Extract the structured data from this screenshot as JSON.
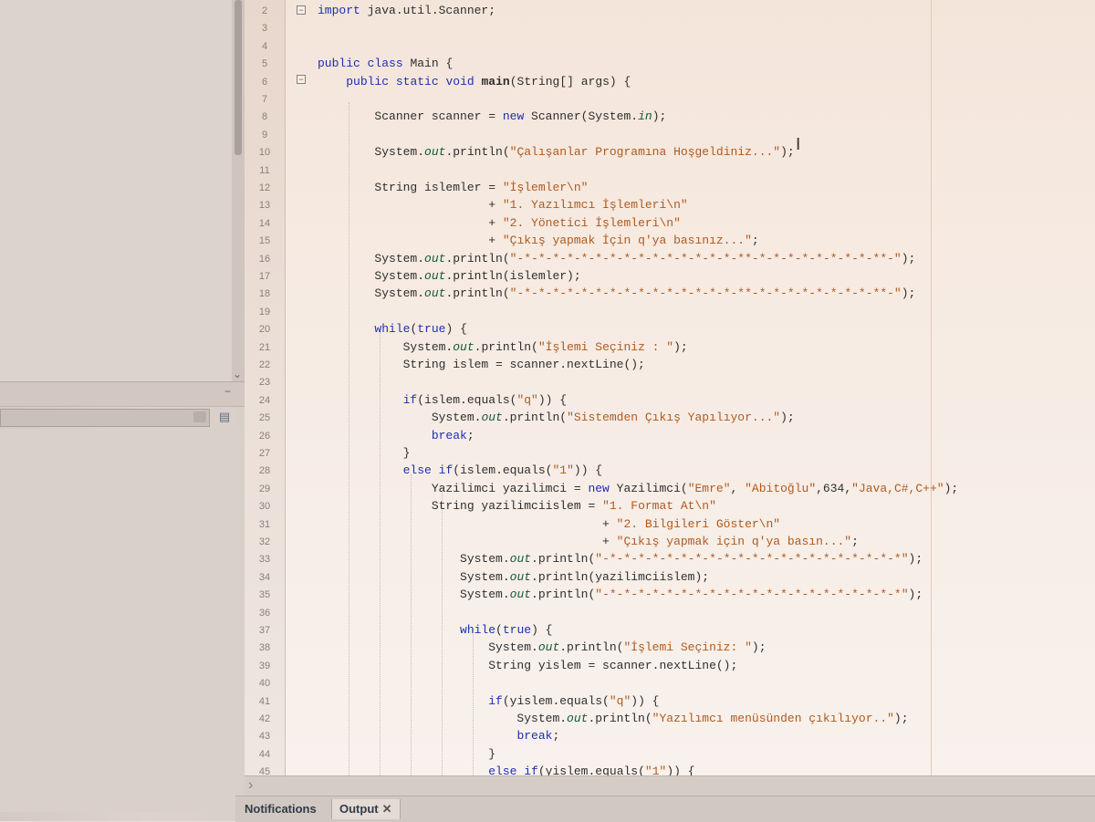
{
  "editor": {
    "lines": [
      {
        "n": "2",
        "text": "import java.util.Scanner;"
      },
      {
        "n": "3",
        "text": ""
      },
      {
        "n": "4",
        "text": ""
      },
      {
        "n": "5",
        "text": "public class Main {"
      },
      {
        "n": "6",
        "text": "    public static void main(String[] args) {"
      },
      {
        "n": "7",
        "text": ""
      },
      {
        "n": "8",
        "text": "        Scanner scanner = new Scanner(System.in);"
      },
      {
        "n": "9",
        "text": ""
      },
      {
        "n": "10",
        "text": "        System.out.println(\"Çalışanlar Programına Hoşgeldiniz...\");"
      },
      {
        "n": "11",
        "text": ""
      },
      {
        "n": "12",
        "text": "        String islemler = \"İşlemler\\n\""
      },
      {
        "n": "13",
        "text": "                        + \"1. Yazılımcı İşlemleri\\n\""
      },
      {
        "n": "14",
        "text": "                        + \"2. Yönetici İşlemleri\\n\""
      },
      {
        "n": "15",
        "text": "                        + \"Çıkış yapmak İçin q'ya basınız...\";"
      },
      {
        "n": "16",
        "text": "        System.out.println(\"-*-*-*-*-*-*-*-*-*-*-*-*-*-*-*-**-*-*-*-*-*-*-*-*-**-\");"
      },
      {
        "n": "17",
        "text": "        System.out.println(islemler);"
      },
      {
        "n": "18",
        "text": "        System.out.println(\"-*-*-*-*-*-*-*-*-*-*-*-*-*-*-*-**-*-*-*-*-*-*-*-*-**-\");"
      },
      {
        "n": "19",
        "text": ""
      },
      {
        "n": "20",
        "text": "        while(true) {"
      },
      {
        "n": "21",
        "text": "            System.out.println(\"İşlemi Seçiniz : \");"
      },
      {
        "n": "22",
        "text": "            String islem = scanner.nextLine();"
      },
      {
        "n": "23",
        "text": ""
      },
      {
        "n": "24",
        "text": "            if(islem.equals(\"q\")) {"
      },
      {
        "n": "25",
        "text": "                System.out.println(\"Sistemden Çıkış Yapılıyor...\");"
      },
      {
        "n": "26",
        "text": "                break;"
      },
      {
        "n": "27",
        "text": "            }"
      },
      {
        "n": "28",
        "text": "            else if(islem.equals(\"1\")) {"
      },
      {
        "n": "29",
        "text": "                Yazilimci yazilimci = new Yazilimci(\"Emre\", \"Abitoğlu\",634,\"Java,C#,C++\");"
      },
      {
        "n": "30",
        "text": "                String yazilimciislem = \"1. Format At\\n\""
      },
      {
        "n": "31",
        "text": "                                        + \"2. Bilgileri Göster\\n\""
      },
      {
        "n": "32",
        "text": "                                        + \"Çıkış yapmak için q'ya basın...\";"
      },
      {
        "n": "33",
        "text": "                    System.out.println(\"-*-*-*-*-*-*-*-*-*-*-*-*-*-*-*-*-*-*-*-*-*\");"
      },
      {
        "n": "34",
        "text": "                    System.out.println(yazilimciislem);"
      },
      {
        "n": "35",
        "text": "                    System.out.println(\"-*-*-*-*-*-*-*-*-*-*-*-*-*-*-*-*-*-*-*-*-*\");"
      },
      {
        "n": "36",
        "text": ""
      },
      {
        "n": "37",
        "text": "                    while(true) {"
      },
      {
        "n": "38",
        "text": "                        System.out.println(\"İşlemi Seçiniz: \");"
      },
      {
        "n": "39",
        "text": "                        String yislem = scanner.nextLine();"
      },
      {
        "n": "40",
        "text": ""
      },
      {
        "n": "41",
        "text": "                        if(yislem.equals(\"q\")) {"
      },
      {
        "n": "42",
        "text": "                            System.out.println(\"Yazılımcı menüsünden çıkılıyor..\");"
      },
      {
        "n": "43",
        "text": "                            break;"
      },
      {
        "n": "44",
        "text": "                        }"
      },
      {
        "n": "45",
        "text": "                        else if(yislem.equals(\"1\")) {"
      }
    ]
  },
  "bottom_tabs": {
    "notifications": "Notifications",
    "output": "Output",
    "close_glyph": "✕"
  },
  "icons": {
    "fold": "−",
    "scroll_down": "⌄",
    "minimize": "−",
    "panel": "▤",
    "h_scroll": "›",
    "ibeam": "I"
  }
}
